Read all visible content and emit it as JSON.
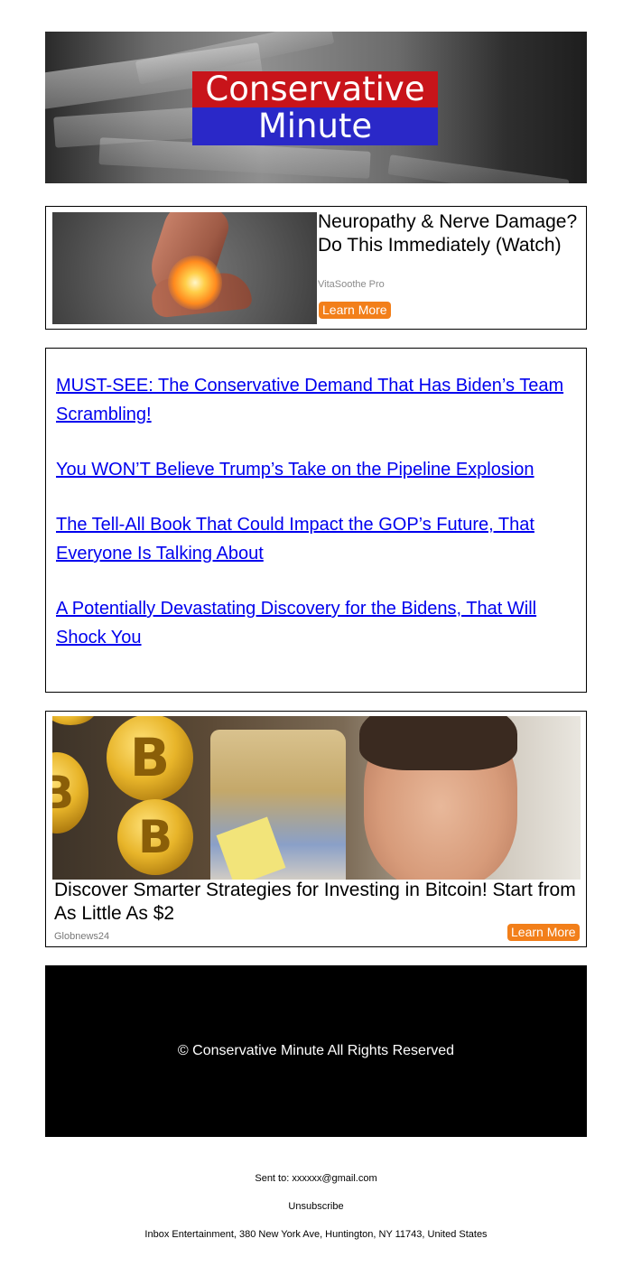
{
  "header": {
    "logo_line1": "Conservative",
    "logo_line2": "Minute",
    "colors": {
      "red": "#c8141a",
      "blue": "#2a28c8"
    }
  },
  "ad1": {
    "image_icon": "foot-pain-photo",
    "title": "Neuropathy & Nerve Damage? Do This Immediately (Watch)",
    "source": "VitaSoothe Pro",
    "button": "Learn More"
  },
  "links": [
    "MUST-SEE: The Conservative Demand That Has Biden’s Team Scrambling!",
    "You WON’T Believe Trump’s Take on the Pipeline Explosion",
    "The Tell-All Book That Could Impact the GOP’s Future, That Everyone Is Talking About",
    "A Potentially Devastating Discovery for the Bidens, That Will Shock You"
  ],
  "ad2": {
    "image_icon": "bitcoin-man-photo",
    "coin_symbol": "B",
    "title": "Discover Smarter Strategies for Investing in Bitcoin! Start from As Little As $2",
    "source": "Globnews24",
    "button": "Learn More"
  },
  "footer": {
    "copyright": "© Conservative Minute All Rights Reserved",
    "sent_to": "Sent to: xxxxxx@gmail.com",
    "unsubscribe": "Unsubscribe",
    "address": "Inbox Entertainment, 380 New York Ave, Huntington, NY 11743, United States"
  },
  "accent_color": "#f27f1a"
}
